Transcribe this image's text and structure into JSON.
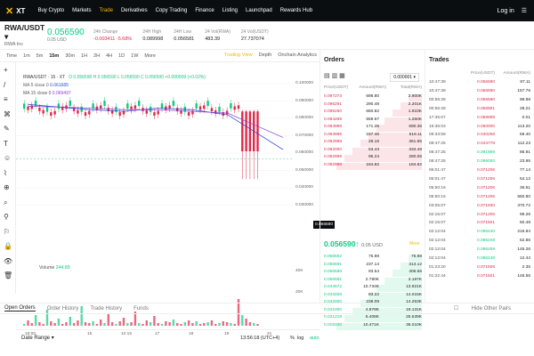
{
  "nav": {
    "brand": "XT",
    "items": [
      "Buy Crypto",
      "Markets",
      "Trade",
      "Derivatives",
      "Copy Trading",
      "Finance",
      "Listing",
      "Launchpad",
      "Rewards Hub"
    ],
    "active_index": 2,
    "login": "Log in",
    "accent": "#f0b90b"
  },
  "ticker": {
    "pair": "RWA/USDT",
    "project": "RWA Inc",
    "price": "0.056590",
    "price_usd": "0.05 USD",
    "stats": [
      {
        "label": "24h Change",
        "value": "-0.003411 -5.68%",
        "color": "#e0294a"
      },
      {
        "label": "24H High",
        "value": "0.089998",
        "color": "#222222"
      },
      {
        "label": "24H Low",
        "value": "0.056581",
        "color": "#222222"
      },
      {
        "label": "24 Vol(RWA)",
        "value": "483.39",
        "color": "#222222"
      },
      {
        "label": "24 Vol(USDT)",
        "value": "27.737074",
        "color": "#222222"
      }
    ]
  },
  "chart_toolbar": {
    "intervals": [
      "Time",
      "1m",
      "5m",
      "15m",
      "30m",
      "1H",
      "2H",
      "4H",
      "1D",
      "1W",
      "More"
    ],
    "active": "15m",
    "views": [
      "Trading View",
      "Depth",
      "Onchain Analytics"
    ]
  },
  "chart": {
    "pair_label": "RWA/USDT · 15 · XT",
    "ohlc": "O 0.056590 H 0.056590 L 0.056590 C 0.056590 +0.000009 (+0.02%)",
    "ma5": {
      "label": "MA 5 close 0",
      "value": "0.061685",
      "color": "#1b3fd6"
    },
    "ma15": {
      "label": "MA 15 close 0",
      "value": "0.069497",
      "color": "#8a3fd6"
    },
    "y_ticks": [
      "0.100000",
      "0.090000",
      "0.080000",
      "0.070000",
      "0.060000",
      "0.050000",
      "0.040000",
      "0.030000"
    ],
    "current_price": "0.056590",
    "volume_label": "Volume",
    "volume_value": "244.89",
    "vol_ticks": [
      "40K",
      "20K"
    ],
    "x_ticks": [
      "16:00",
      "15",
      "12:15",
      "17",
      "18",
      "19",
      "21"
    ],
    "date_range": "Date Range",
    "time": "13:56:18 (UTC+4)",
    "pct": "%",
    "log": "log",
    "auto": "auto",
    "tools": [
      "+",
      "/",
      "≡",
      "⌘",
      "✎",
      "T",
      "☺",
      "⌇",
      "⊕",
      "⌕",
      "⚲",
      "⚐",
      "🔒",
      "👁",
      "🗑"
    ]
  },
  "chart_data": {
    "type": "line",
    "title": "",
    "xlabel": "",
    "ylabel": "",
    "ylim": [
      0.03,
      0.1
    ],
    "x": [
      "16:00",
      "15",
      "12:15",
      "17",
      "18",
      "19",
      "21"
    ],
    "series": [
      {
        "name": "MA 5 close 0",
        "values": [
          0.088,
          0.085,
          0.084,
          0.086,
          0.085,
          0.082,
          0.062
        ]
      },
      {
        "name": "MA 15 close 0",
        "values": [
          0.087,
          0.086,
          0.085,
          0.085,
          0.084,
          0.083,
          0.069
        ]
      }
    ]
  },
  "orders": {
    "title": "Orders",
    "precision": "0.000001",
    "headers": [
      "Price(USDT)",
      "Amount(RWA)",
      "Total(RWA)"
    ],
    "asks": [
      [
        "0.097273",
        "698.80",
        "2.900K"
      ],
      [
        "0.096291",
        "290.48",
        "2.201K"
      ],
      [
        "0.095250",
        "660.82",
        "1.910K"
      ],
      [
        "0.094269",
        "559.67",
        "1.250K"
      ],
      [
        "0.084998",
        "171.25",
        "690.36"
      ],
      [
        "0.083999",
        "157.46",
        "519.11"
      ],
      [
        "0.082998",
        "28.16",
        "361.65"
      ],
      [
        "0.082000",
        "53.43",
        "333.49"
      ],
      [
        "0.082999",
        "95.24",
        "280.06"
      ],
      [
        "0.082998",
        "184.82",
        "184.82"
      ]
    ],
    "mid_price": "0.056590↑",
    "mid_usd": "0.05 USD",
    "more": "More",
    "bids": [
      [
        "0.056592",
        "75.98",
        "75.98"
      ],
      [
        "0.056591",
        "237.14",
        "313.12"
      ],
      [
        "0.056588",
        "93.54",
        "406.66"
      ],
      [
        "0.056581",
        "2.780K",
        "3.187K"
      ],
      [
        "0.044672",
        "10.734K",
        "13.921K"
      ],
      [
        "0.043258",
        "93.22",
        "14.015K"
      ],
      [
        "0.042000",
        "238.09",
        "14.253K"
      ],
      [
        "0.041000",
        "4.878K",
        "19.131K"
      ],
      [
        "0.031218",
        "6.408K",
        "25.539K"
      ],
      [
        "0.019100",
        "10.471K",
        "36.010K"
      ]
    ]
  },
  "trades": {
    "title": "Trades",
    "headers": [
      "",
      "Price(USDT)",
      "Amount(RWA)"
    ],
    "rows": [
      [
        "10:47:39",
        "0.056590",
        "87.11",
        "red"
      ],
      [
        "10:47:39",
        "0.056590",
        "157.76",
        "red"
      ],
      [
        "00:56:28",
        "0.056590",
        "98.88",
        "red"
      ],
      [
        "00:56:28",
        "0.056581",
        "28.21",
        "red"
      ],
      [
        "17:35:07",
        "0.058998",
        "0.01",
        "red"
      ],
      [
        "15:36:03",
        "0.060000",
        "113.20",
        "red"
      ],
      [
        "09:33:59",
        "0.040258",
        "59.40",
        "red"
      ],
      [
        "08:47:25",
        "0.044778",
        "112.23",
        "red"
      ],
      [
        "08:47:25",
        "0.091999",
        "86.91",
        "green"
      ],
      [
        "08:47:25",
        "0.096000",
        "23.95",
        "green"
      ],
      [
        "06:01:47",
        "0.071206",
        "77.14",
        "red"
      ],
      [
        "06:01:47",
        "0.071206",
        "54.12",
        "red"
      ],
      [
        "05:50:16",
        "0.071206",
        "36.61",
        "red"
      ],
      [
        "05:50:16",
        "0.071206",
        "550.80",
        "red"
      ],
      [
        "03:05:07",
        "0.071930",
        "370.72",
        "red"
      ],
      [
        "02:15:07",
        "0.071206",
        "99.26",
        "red"
      ],
      [
        "02:15:07",
        "0.071501",
        "50.48",
        "red"
      ],
      [
        "02:12:04",
        "0.096240",
        "216.84",
        "green"
      ],
      [
        "02:12:04",
        "0.096248",
        "52.85",
        "green"
      ],
      [
        "02:12:04",
        "0.096269",
        "145.26",
        "green"
      ],
      [
        "02:12:04",
        "0.096249",
        "12.44",
        "green"
      ],
      [
        "01:23:20",
        "0.071506",
        "2.35",
        "red"
      ],
      [
        "01:22:44",
        "0.071501",
        "145.56",
        "red"
      ]
    ]
  },
  "bottom": {
    "tabs": [
      "Open Orders",
      "Order History",
      "Trade History",
      "Funds"
    ],
    "hide_other": "Hide Other Pairs"
  }
}
